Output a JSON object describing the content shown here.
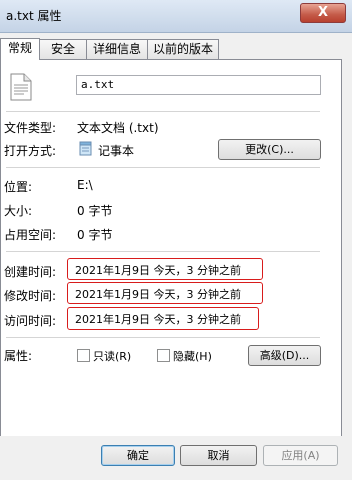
{
  "window": {
    "title": "a.txt 属性",
    "close_glyph": "X"
  },
  "tabs": [
    {
      "label": "常规",
      "active": true
    },
    {
      "label": "安全"
    },
    {
      "label": "详细信息"
    },
    {
      "label": "以前的版本"
    }
  ],
  "file": {
    "name": "a.txt",
    "icon": "text-file-icon"
  },
  "props": {
    "type_label": "文件类型:",
    "type_value": "文本文档 (.txt)",
    "open_label": "打开方式:",
    "open_app": "记事本",
    "open_app_icon": "notepad-icon",
    "change_button": "更改(C)...",
    "location_label": "位置:",
    "location_value": "E:\\",
    "size_label": "大小:",
    "size_value": "0 字节",
    "disk_label": "占用空间:",
    "disk_value": "0 字节",
    "created_label": "创建时间:",
    "created_value": "2021年1月9日 今天，3 分钟之前",
    "modified_label": "修改时间:",
    "modified_value": "2021年1月9日 今天，3 分钟之前",
    "accessed_label": "访问时间:",
    "accessed_value": "2021年1月9日 今天，3 分钟之前",
    "attributes_label": "属性:",
    "readonly_label": "只读(R)",
    "hidden_label": "隐藏(H)",
    "advanced_button": "高级(D)..."
  },
  "footer": {
    "ok": "确定",
    "cancel": "取消",
    "apply": "应用(A)"
  },
  "colors": {
    "highlight_box": "#d81c1c",
    "title_gradient": "#c4d3e6"
  }
}
